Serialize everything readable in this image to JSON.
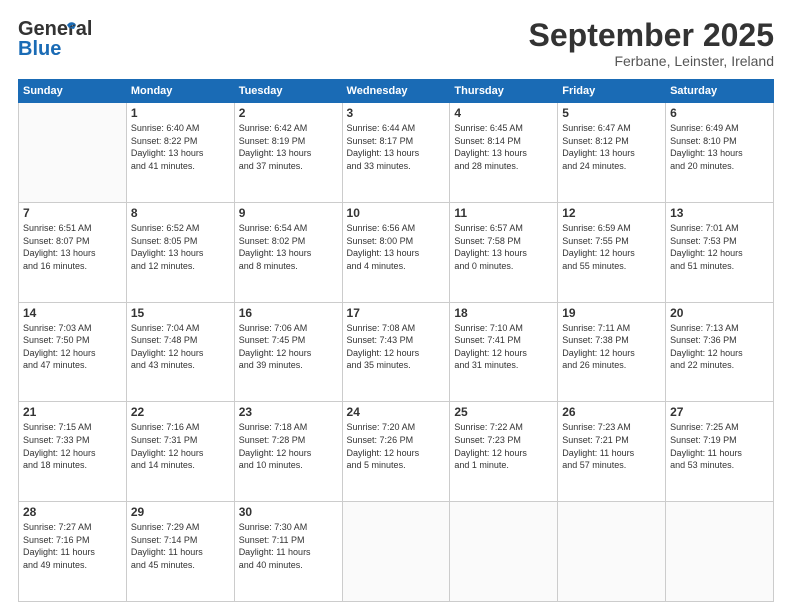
{
  "header": {
    "logo_general": "General",
    "logo_blue": "Blue",
    "month_title": "September 2025",
    "location": "Ferbane, Leinster, Ireland"
  },
  "days_of_week": [
    "Sunday",
    "Monday",
    "Tuesday",
    "Wednesday",
    "Thursday",
    "Friday",
    "Saturday"
  ],
  "weeks": [
    [
      {
        "day": "",
        "info": ""
      },
      {
        "day": "1",
        "info": "Sunrise: 6:40 AM\nSunset: 8:22 PM\nDaylight: 13 hours\nand 41 minutes."
      },
      {
        "day": "2",
        "info": "Sunrise: 6:42 AM\nSunset: 8:19 PM\nDaylight: 13 hours\nand 37 minutes."
      },
      {
        "day": "3",
        "info": "Sunrise: 6:44 AM\nSunset: 8:17 PM\nDaylight: 13 hours\nand 33 minutes."
      },
      {
        "day": "4",
        "info": "Sunrise: 6:45 AM\nSunset: 8:14 PM\nDaylight: 13 hours\nand 28 minutes."
      },
      {
        "day": "5",
        "info": "Sunrise: 6:47 AM\nSunset: 8:12 PM\nDaylight: 13 hours\nand 24 minutes."
      },
      {
        "day": "6",
        "info": "Sunrise: 6:49 AM\nSunset: 8:10 PM\nDaylight: 13 hours\nand 20 minutes."
      }
    ],
    [
      {
        "day": "7",
        "info": "Sunrise: 6:51 AM\nSunset: 8:07 PM\nDaylight: 13 hours\nand 16 minutes."
      },
      {
        "day": "8",
        "info": "Sunrise: 6:52 AM\nSunset: 8:05 PM\nDaylight: 13 hours\nand 12 minutes."
      },
      {
        "day": "9",
        "info": "Sunrise: 6:54 AM\nSunset: 8:02 PM\nDaylight: 13 hours\nand 8 minutes."
      },
      {
        "day": "10",
        "info": "Sunrise: 6:56 AM\nSunset: 8:00 PM\nDaylight: 13 hours\nand 4 minutes."
      },
      {
        "day": "11",
        "info": "Sunrise: 6:57 AM\nSunset: 7:58 PM\nDaylight: 13 hours\nand 0 minutes."
      },
      {
        "day": "12",
        "info": "Sunrise: 6:59 AM\nSunset: 7:55 PM\nDaylight: 12 hours\nand 55 minutes."
      },
      {
        "day": "13",
        "info": "Sunrise: 7:01 AM\nSunset: 7:53 PM\nDaylight: 12 hours\nand 51 minutes."
      }
    ],
    [
      {
        "day": "14",
        "info": "Sunrise: 7:03 AM\nSunset: 7:50 PM\nDaylight: 12 hours\nand 47 minutes."
      },
      {
        "day": "15",
        "info": "Sunrise: 7:04 AM\nSunset: 7:48 PM\nDaylight: 12 hours\nand 43 minutes."
      },
      {
        "day": "16",
        "info": "Sunrise: 7:06 AM\nSunset: 7:45 PM\nDaylight: 12 hours\nand 39 minutes."
      },
      {
        "day": "17",
        "info": "Sunrise: 7:08 AM\nSunset: 7:43 PM\nDaylight: 12 hours\nand 35 minutes."
      },
      {
        "day": "18",
        "info": "Sunrise: 7:10 AM\nSunset: 7:41 PM\nDaylight: 12 hours\nand 31 minutes."
      },
      {
        "day": "19",
        "info": "Sunrise: 7:11 AM\nSunset: 7:38 PM\nDaylight: 12 hours\nand 26 minutes."
      },
      {
        "day": "20",
        "info": "Sunrise: 7:13 AM\nSunset: 7:36 PM\nDaylight: 12 hours\nand 22 minutes."
      }
    ],
    [
      {
        "day": "21",
        "info": "Sunrise: 7:15 AM\nSunset: 7:33 PM\nDaylight: 12 hours\nand 18 minutes."
      },
      {
        "day": "22",
        "info": "Sunrise: 7:16 AM\nSunset: 7:31 PM\nDaylight: 12 hours\nand 14 minutes."
      },
      {
        "day": "23",
        "info": "Sunrise: 7:18 AM\nSunset: 7:28 PM\nDaylight: 12 hours\nand 10 minutes."
      },
      {
        "day": "24",
        "info": "Sunrise: 7:20 AM\nSunset: 7:26 PM\nDaylight: 12 hours\nand 5 minutes."
      },
      {
        "day": "25",
        "info": "Sunrise: 7:22 AM\nSunset: 7:23 PM\nDaylight: 12 hours\nand 1 minute."
      },
      {
        "day": "26",
        "info": "Sunrise: 7:23 AM\nSunset: 7:21 PM\nDaylight: 11 hours\nand 57 minutes."
      },
      {
        "day": "27",
        "info": "Sunrise: 7:25 AM\nSunset: 7:19 PM\nDaylight: 11 hours\nand 53 minutes."
      }
    ],
    [
      {
        "day": "28",
        "info": "Sunrise: 7:27 AM\nSunset: 7:16 PM\nDaylight: 11 hours\nand 49 minutes."
      },
      {
        "day": "29",
        "info": "Sunrise: 7:29 AM\nSunset: 7:14 PM\nDaylight: 11 hours\nand 45 minutes."
      },
      {
        "day": "30",
        "info": "Sunrise: 7:30 AM\nSunset: 7:11 PM\nDaylight: 11 hours\nand 40 minutes."
      },
      {
        "day": "",
        "info": ""
      },
      {
        "day": "",
        "info": ""
      },
      {
        "day": "",
        "info": ""
      },
      {
        "day": "",
        "info": ""
      }
    ]
  ]
}
